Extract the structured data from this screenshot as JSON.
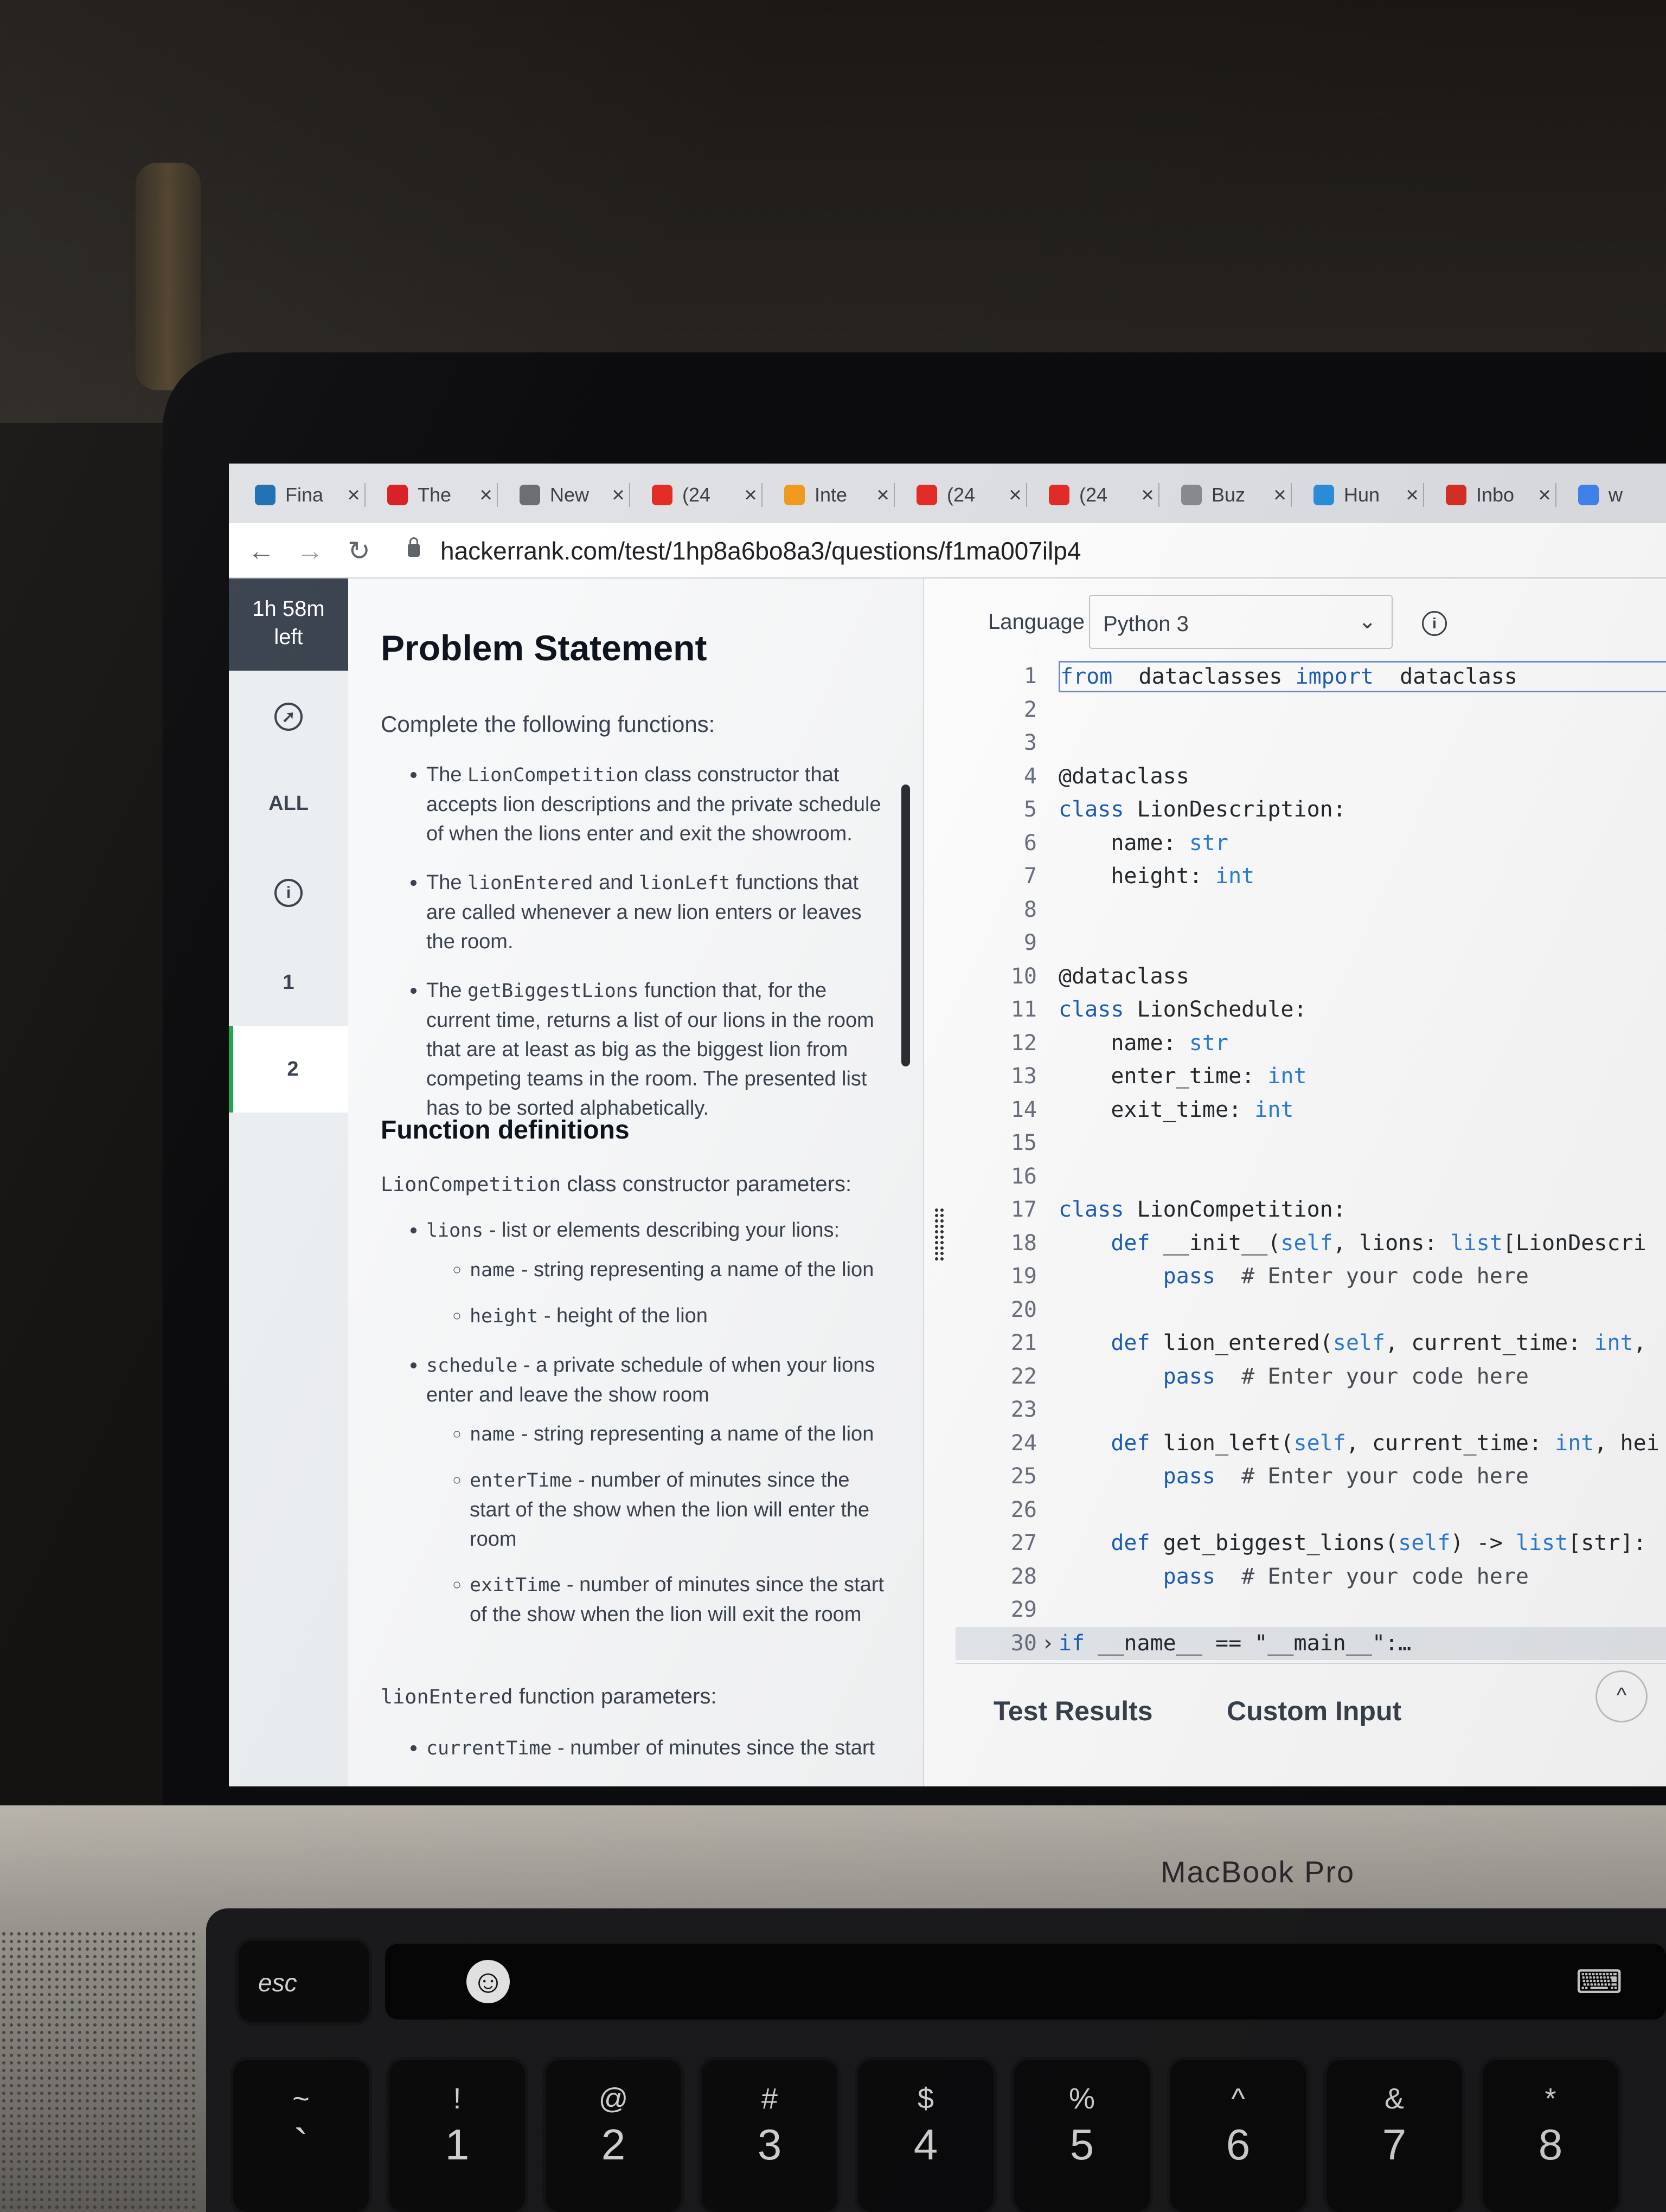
{
  "browser": {
    "tabs": [
      {
        "label": "Fina",
        "favicon_color": "#1f6fb3",
        "icon": "trello-icon"
      },
      {
        "label": "The",
        "favicon_color": "#d81f26",
        "icon": "youtube-icon"
      },
      {
        "label": "New",
        "favicon_color": "#6b6f73",
        "icon": "chatgpt-icon"
      },
      {
        "label": "(24",
        "favicon_color": "#e52d27",
        "icon": "youtube-icon"
      },
      {
        "label": "Inte",
        "favicon_color": "#f29b1d",
        "icon": "app-icon"
      },
      {
        "label": "(24",
        "favicon_color": "#e52d27",
        "icon": "youtube-icon"
      },
      {
        "label": "(24",
        "favicon_color": "#e52d27",
        "icon": "youtube-icon"
      },
      {
        "label": "Buz",
        "favicon_color": "#8a8d91",
        "icon": "buzz-icon"
      },
      {
        "label": "Hun",
        "favicon_color": "#2b8fe0",
        "icon": "globe-icon"
      },
      {
        "label": "Inbo",
        "favicon_color": "#d93025",
        "icon": "gmail-icon"
      },
      {
        "label": "w",
        "favicon_color": "#4285f4",
        "icon": "google-icon"
      }
    ],
    "url": "hackerrank.com/test/1hp8a6bo8a3/questions/f1ma007ilp4"
  },
  "sidebar": {
    "timer_line1": "1h 58m",
    "timer_line2": "left",
    "items": [
      {
        "label": "ALL"
      },
      {
        "label": "1"
      },
      {
        "label": "2"
      }
    ]
  },
  "problem": {
    "title": "Problem Statement",
    "intro": "Complete the following functions:",
    "bullets": [
      {
        "pre": "The ",
        "code": "LionCompetition",
        "post": " class constructor that accepts lion descriptions and the private schedule of when the lions enter and exit the showroom."
      },
      {
        "pre": "The ",
        "code": "lionEntered",
        "mid": " and ",
        "code2": "lionLeft",
        "post": " functions that are called whenever a new lion enters or leaves the room."
      },
      {
        "pre": "The ",
        "code": "getBiggestLions",
        "post": " function that, for the current time, returns a list of our lions in the room that are at least as big as the biggest lion from competing teams in the room. The presented list has to be sorted alphabetically."
      }
    ],
    "fd_title": "Function definitions",
    "ctor_code": "LionCompetition",
    "ctor_text": " class constructor parameters:",
    "params": {
      "lions_code": "lions",
      "lions_text": " - list or elements describing your lions:",
      "name_code": "name",
      "name_text": " - string representing a name of the lion",
      "height_code": "height",
      "height_text": " - height of the lion",
      "schedule_code": "schedule",
      "schedule_text": " - a private schedule of when your lions enter and leave the show room",
      "name2_code": "name",
      "name2_text": " - string representing a name of the lion",
      "enter_code": "enterTime",
      "enter_text": " - number of minutes since the start of the show when the lion will enter the room",
      "exit_code": "exitTime",
      "exit_text": " - number of minutes since the start of the show when the lion will exit the room"
    },
    "entered_code": "lionEntered",
    "entered_text": " function parameters:",
    "current_code": "currentTime",
    "current_text": " - number of minutes since the start"
  },
  "editor": {
    "language_label": "Language",
    "language_value": "Python 3",
    "chevron": "⌄",
    "info": "i",
    "lines": [
      {
        "n": "1",
        "s": [
          [
            "kw",
            "from"
          ],
          [
            "",
            "  dataclasses "
          ],
          [
            "kw",
            "import"
          ],
          [
            "",
            "  dataclass"
          ]
        ]
      },
      {
        "n": "2",
        "s": []
      },
      {
        "n": "3",
        "s": []
      },
      {
        "n": "4",
        "s": [
          [
            "",
            "@dataclass"
          ]
        ]
      },
      {
        "n": "5",
        "s": [
          [
            "kw",
            "class"
          ],
          [
            "",
            " LionDescription:"
          ]
        ]
      },
      {
        "n": "6",
        "s": [
          [
            "",
            "    name: "
          ],
          [
            "ty",
            "str"
          ]
        ]
      },
      {
        "n": "7",
        "s": [
          [
            "",
            "    height: "
          ],
          [
            "ty",
            "int"
          ]
        ]
      },
      {
        "n": "8",
        "s": []
      },
      {
        "n": "9",
        "s": []
      },
      {
        "n": "10",
        "s": [
          [
            "",
            "@dataclass"
          ]
        ]
      },
      {
        "n": "11",
        "s": [
          [
            "kw",
            "class"
          ],
          [
            "",
            " LionSchedule:"
          ]
        ]
      },
      {
        "n": "12",
        "s": [
          [
            "",
            "    name: "
          ],
          [
            "ty",
            "str"
          ]
        ]
      },
      {
        "n": "13",
        "s": [
          [
            "",
            "    enter_time: "
          ],
          [
            "ty",
            "int"
          ]
        ]
      },
      {
        "n": "14",
        "s": [
          [
            "",
            "    exit_time: "
          ],
          [
            "ty",
            "int"
          ]
        ]
      },
      {
        "n": "15",
        "s": []
      },
      {
        "n": "16",
        "s": []
      },
      {
        "n": "17",
        "s": [
          [
            "kw",
            "class"
          ],
          [
            "",
            " LionCompetition:"
          ]
        ]
      },
      {
        "n": "18",
        "s": [
          [
            "",
            "    "
          ],
          [
            "kw",
            "def"
          ],
          [
            "",
            " __init__("
          ],
          [
            "ty",
            "self"
          ],
          [
            "",
            ", lions: "
          ],
          [
            "ty",
            "list"
          ],
          [
            "",
            "[LionDescri"
          ]
        ]
      },
      {
        "n": "19",
        "s": [
          [
            "",
            "        "
          ],
          [
            "kw",
            "pass"
          ],
          [
            "cm",
            "  # Enter your code here"
          ]
        ]
      },
      {
        "n": "20",
        "s": []
      },
      {
        "n": "21",
        "s": [
          [
            "",
            "    "
          ],
          [
            "kw",
            "def"
          ],
          [
            "",
            " lion_entered("
          ],
          [
            "ty",
            "self"
          ],
          [
            "",
            ", current_time: "
          ],
          [
            "ty",
            "int"
          ],
          [
            "",
            ","
          ]
        ]
      },
      {
        "n": "22",
        "s": [
          [
            "",
            "        "
          ],
          [
            "kw",
            "pass"
          ],
          [
            "cm",
            "  # Enter your code here"
          ]
        ]
      },
      {
        "n": "23",
        "s": []
      },
      {
        "n": "24",
        "s": [
          [
            "",
            "    "
          ],
          [
            "kw",
            "def"
          ],
          [
            "",
            " lion_left("
          ],
          [
            "ty",
            "self"
          ],
          [
            "",
            ", current_time: "
          ],
          [
            "ty",
            "int"
          ],
          [
            "",
            ", hei"
          ]
        ]
      },
      {
        "n": "25",
        "s": [
          [
            "",
            "        "
          ],
          [
            "kw",
            "pass"
          ],
          [
            "cm",
            "  # Enter your code here"
          ]
        ]
      },
      {
        "n": "26",
        "s": []
      },
      {
        "n": "27",
        "s": [
          [
            "",
            "    "
          ],
          [
            "kw",
            "def"
          ],
          [
            "",
            " get_biggest_lions("
          ],
          [
            "ty",
            "self"
          ],
          [
            "",
            ") -> "
          ],
          [
            "ty",
            "list"
          ],
          [
            "",
            "[str]:"
          ]
        ]
      },
      {
        "n": "28",
        "s": [
          [
            "",
            "        "
          ],
          [
            "kw",
            "pass"
          ],
          [
            "cm",
            "  # Enter your code here"
          ]
        ]
      },
      {
        "n": "29",
        "s": []
      },
      {
        "n": "30",
        "s": [
          [
            "kw",
            "if"
          ],
          [
            "",
            " __name__ == \"__main__\":…"
          ]
        ]
      }
    ],
    "results_tab": "Test Results",
    "custom_tab": "Custom Input",
    "collapse": "^"
  },
  "hardware": {
    "bezel_logo": "MacBook Pro",
    "esc": "esc",
    "keys": [
      {
        "sym": "~",
        "num": "`"
      },
      {
        "sym": "!",
        "num": "1"
      },
      {
        "sym": "@",
        "num": "2"
      },
      {
        "sym": "#",
        "num": "3"
      },
      {
        "sym": "$",
        "num": "4"
      },
      {
        "sym": "%",
        "num": "5"
      },
      {
        "sym": "^",
        "num": "6"
      },
      {
        "sym": "&",
        "num": "7"
      },
      {
        "sym": "*",
        "num": "8"
      }
    ]
  }
}
